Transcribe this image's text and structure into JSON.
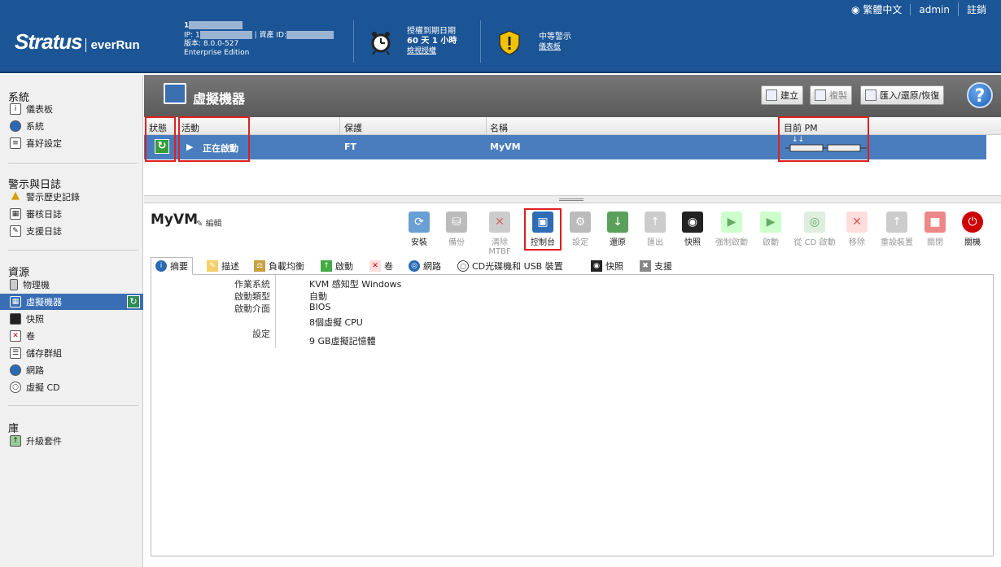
{
  "header": {
    "logo_brand": "Stratus",
    "logo_product": "everRun",
    "sys_name": "1",
    "ip_label": "IP: 1",
    "asset_label": "| 資產 ID:",
    "version": "版本: 8.0.0-527",
    "edition": "Enterprise Edition",
    "license_line1": "授權到期日期",
    "license_line2": "60 天 1 小時",
    "license_link": "檢視授權",
    "alert_line1": "中等警示",
    "alert_link": "儀表板",
    "language": "繁體中文",
    "user": "admin",
    "logout": "註銷"
  },
  "sidebar": {
    "section_system": "系統",
    "dashboard": "儀表板",
    "system": "系統",
    "preferences": "喜好設定",
    "section_alerts": "警示與日誌",
    "alert_history": "警示歷史記錄",
    "audit_log": "審核日誌",
    "support_log": "支援日誌",
    "section_resources": "資源",
    "physical_machines": "物理機",
    "virtual_machines": "虛擬機器",
    "snapshots": "快照",
    "volumes": "卷",
    "storage_groups": "儲存群組",
    "networks": "網路",
    "virtual_cds": "虛擬 CD",
    "section_library": "庫",
    "upgrade_kits": "升級套件"
  },
  "titlebar": {
    "title": "虛擬機器",
    "create": "建立",
    "copy": "複製",
    "import_export": "匯入/還原/恢復",
    "help": "?"
  },
  "grid": {
    "headers": [
      "狀態",
      "活動",
      "保護",
      "名稱",
      "目前 PM"
    ],
    "row": {
      "activity": "正在啟動",
      "protection": "FT",
      "name": "MyVM",
      "pm_arrows": "↓↓"
    }
  },
  "details": {
    "vm_name": "MyVM",
    "edit": "編輯",
    "actions": [
      "安裝",
      "備份",
      "清除 MTBF",
      "控制台",
      "設定",
      "還原",
      "匯出",
      "快照",
      "強制啟動",
      "啟動",
      "從 CD 啟動",
      "移除",
      "重設裝置",
      "關閉",
      "關機"
    ],
    "tabs": [
      "摘要",
      "描述",
      "負載均衡",
      "啟動",
      "卷",
      "網路",
      "CD光碟機和 USB 裝置",
      "快照",
      "支援"
    ],
    "summary": {
      "os_label": "作業系統",
      "os_value": "KVM 感知型 Windows",
      "boot_type_label": "啟動類型",
      "boot_type_value": "自動",
      "boot_iface_label": "啟動介面",
      "boot_iface_value": "BIOS",
      "settings_label": "設定",
      "cpu_value": "8個虛擬 CPU",
      "mem_value": "9 GB虛擬記憶體"
    }
  },
  "colors": {
    "header_bg": "#1b5596",
    "selected_row": "#4a7dbd",
    "highlight": "#e02020"
  }
}
